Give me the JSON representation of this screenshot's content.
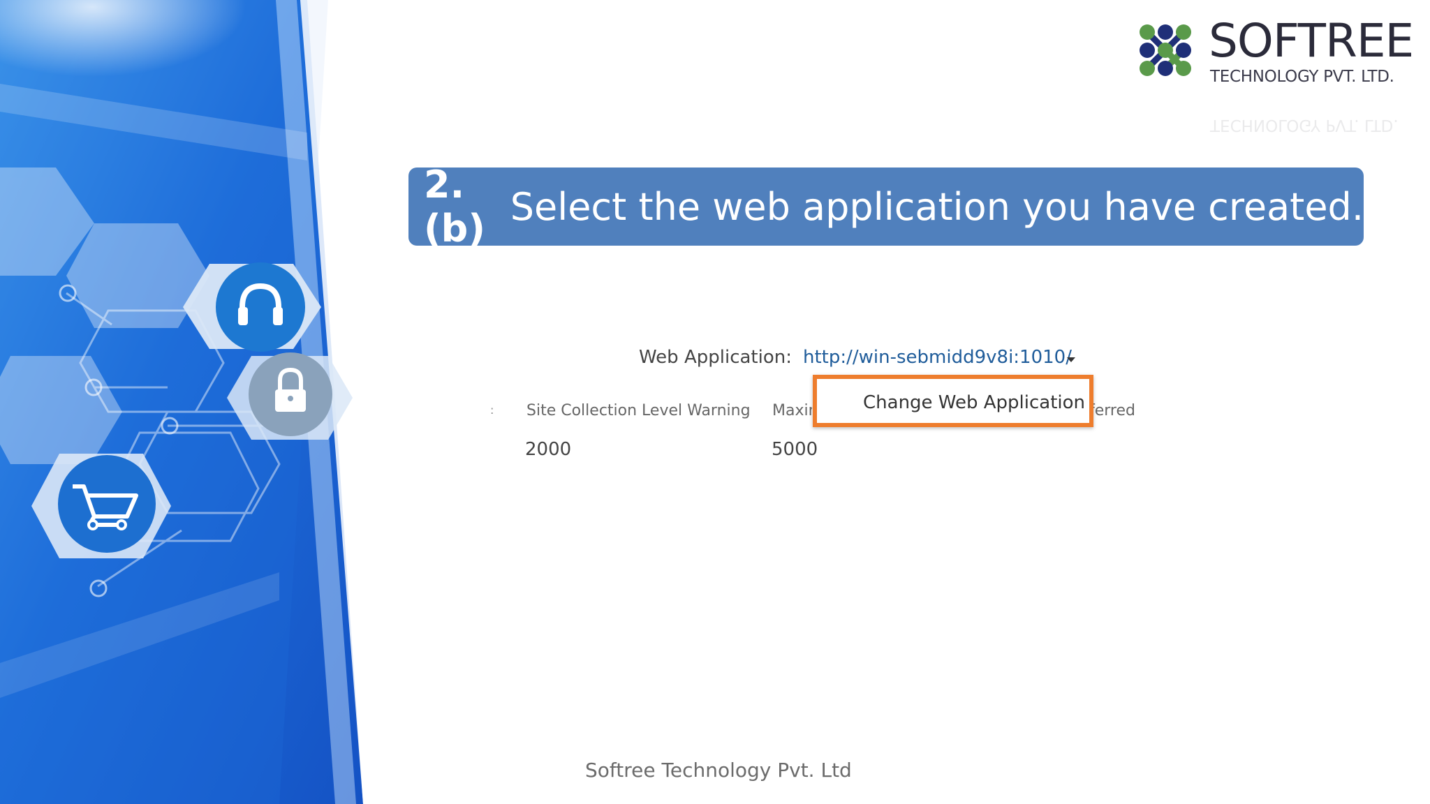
{
  "colors": {
    "banner_bg": "#5080bd",
    "highlight_border": "#ee7d2d",
    "link": "#1f5c9a",
    "logo_green": "#5a9a4a",
    "logo_navy": "#1f2f78"
  },
  "logo": {
    "name": "SOFTREE",
    "subtitle": "TECHNOLOGY PVT. LTD."
  },
  "instruction": {
    "step": "2.(b)",
    "text": "Select the web application you have created."
  },
  "web_application": {
    "label": "Web Application:",
    "url": "http://win-sebmidd9v8i:1010/",
    "dropdown_icon": "caret-down-icon"
  },
  "menu": {
    "item": "Change Web Application"
  },
  "table": {
    "separator": ":",
    "headers": [
      "Site Collection Level Warning",
      "Maximum",
      "Preferred"
    ],
    "values": [
      "2000",
      "5000"
    ]
  },
  "left_art_icons": [
    "headphones-icon",
    "lock-icon",
    "shopping-cart-icon"
  ],
  "footer": {
    "text": "Softree Technology Pvt. Ltd"
  }
}
